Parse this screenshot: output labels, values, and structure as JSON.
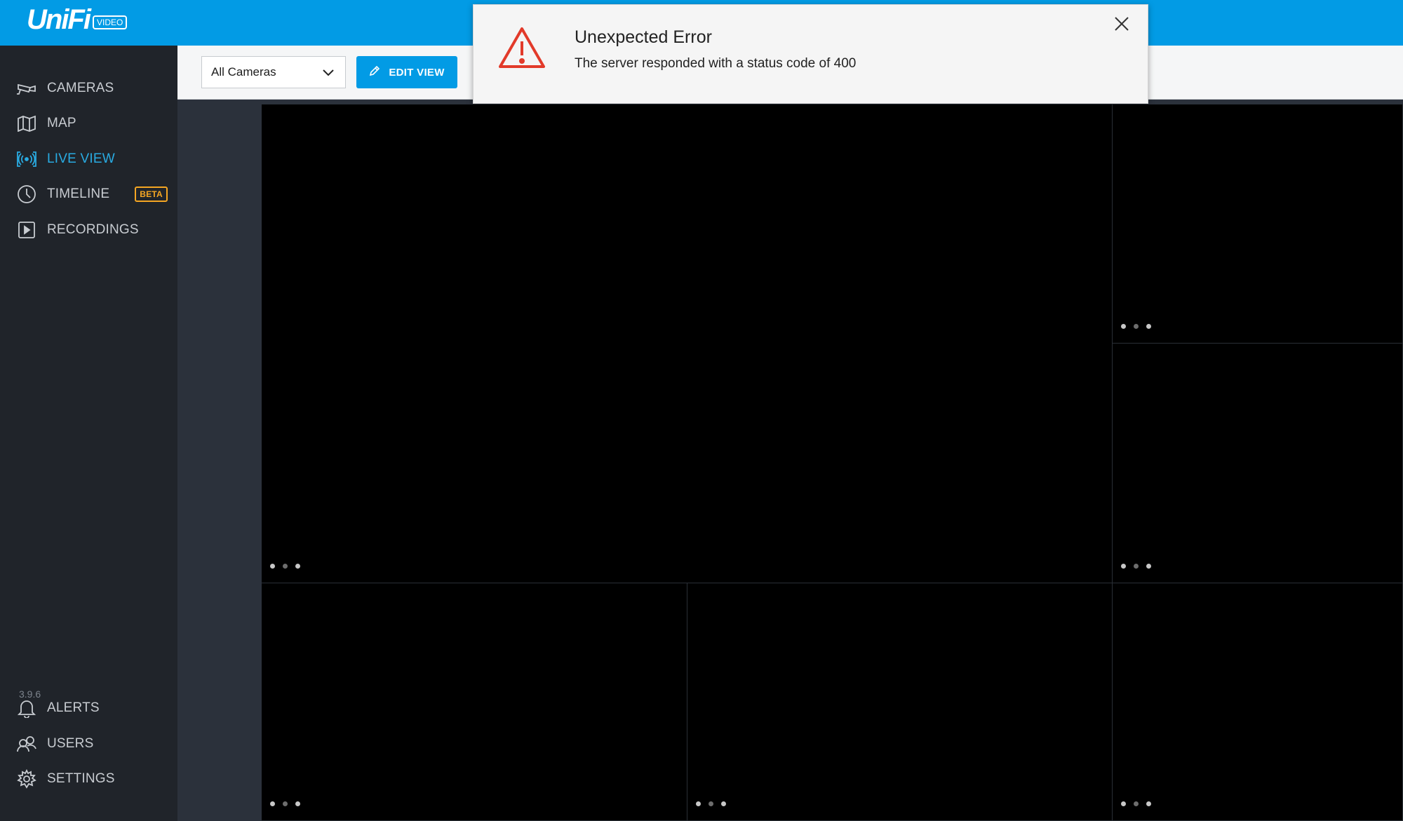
{
  "header": {
    "logo": "UniFi",
    "logo_badge": "VIDEO"
  },
  "sidebar": {
    "items": [
      {
        "label": "CAMERAS",
        "icon": "camera-icon"
      },
      {
        "label": "MAP",
        "icon": "map-icon"
      },
      {
        "label": "LIVE VIEW",
        "icon": "live-view-icon",
        "active": true
      },
      {
        "label": "TIMELINE",
        "icon": "clock-icon",
        "badge": "BETA"
      },
      {
        "label": "RECORDINGS",
        "icon": "play-icon"
      }
    ],
    "version": "3.9.6",
    "bottom_items": [
      {
        "label": "ALERTS",
        "icon": "bell-icon"
      },
      {
        "label": "USERS",
        "icon": "users-icon"
      },
      {
        "label": "SETTINGS",
        "icon": "gear-icon"
      }
    ]
  },
  "toolbar": {
    "camera_select": "All Cameras",
    "edit_view_label": "EDIT VIEW"
  },
  "error_toast": {
    "title": "Unexpected Error",
    "message": "The server responded with a status code of 400"
  },
  "colors": {
    "brand": "#029be5",
    "active_nav": "#29abe2",
    "beta": "#f5a623",
    "error": "#e23a2a"
  }
}
